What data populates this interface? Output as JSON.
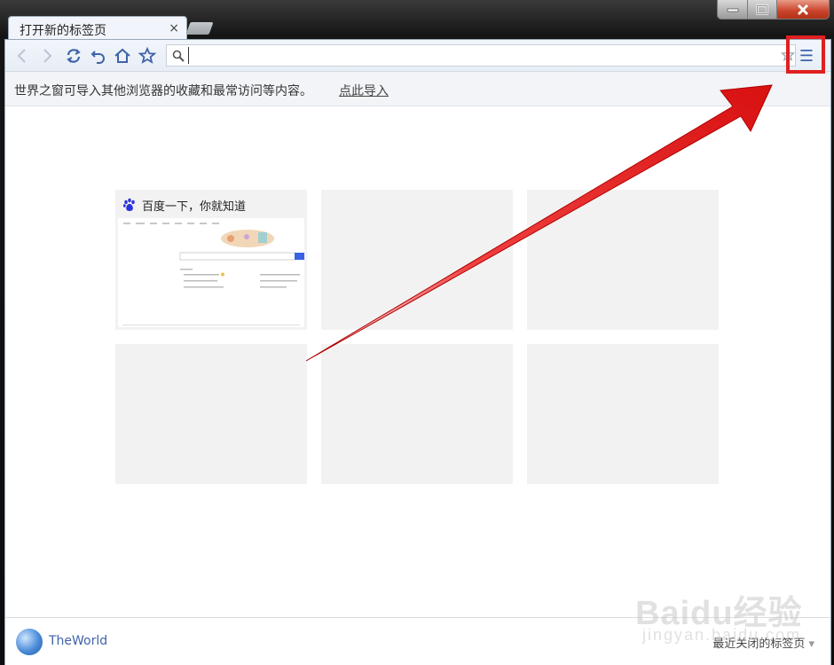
{
  "tab": {
    "title": "打开新的标签页",
    "close_glyph": "×"
  },
  "toolbar": {
    "icons": [
      "back-icon",
      "forward-icon",
      "refresh-icon",
      "undo-icon",
      "home-icon",
      "favorite-star-icon"
    ],
    "address_value": "",
    "menu_glyph": "☰"
  },
  "infobar": {
    "message": "世界之窗可导入其他浏览器的收藏和最常访问等内容。",
    "link": "点此导入"
  },
  "speed_dial": {
    "tiles": [
      {
        "title": "百度一下，你就知道",
        "icon": "baidu-paw-icon"
      },
      {
        "title": ""
      },
      {
        "title": ""
      },
      {
        "title": ""
      },
      {
        "title": ""
      },
      {
        "title": ""
      }
    ]
  },
  "footer": {
    "brand": "TheWorld",
    "recently_closed": "最近关闭的标签页"
  },
  "watermark": {
    "main": "Baidu经验",
    "sub": "jingyan.baidu.com"
  },
  "colors": {
    "accent": "#3f63a8",
    "highlight": "#e02020",
    "tile_bg": "#f2f2f2"
  }
}
